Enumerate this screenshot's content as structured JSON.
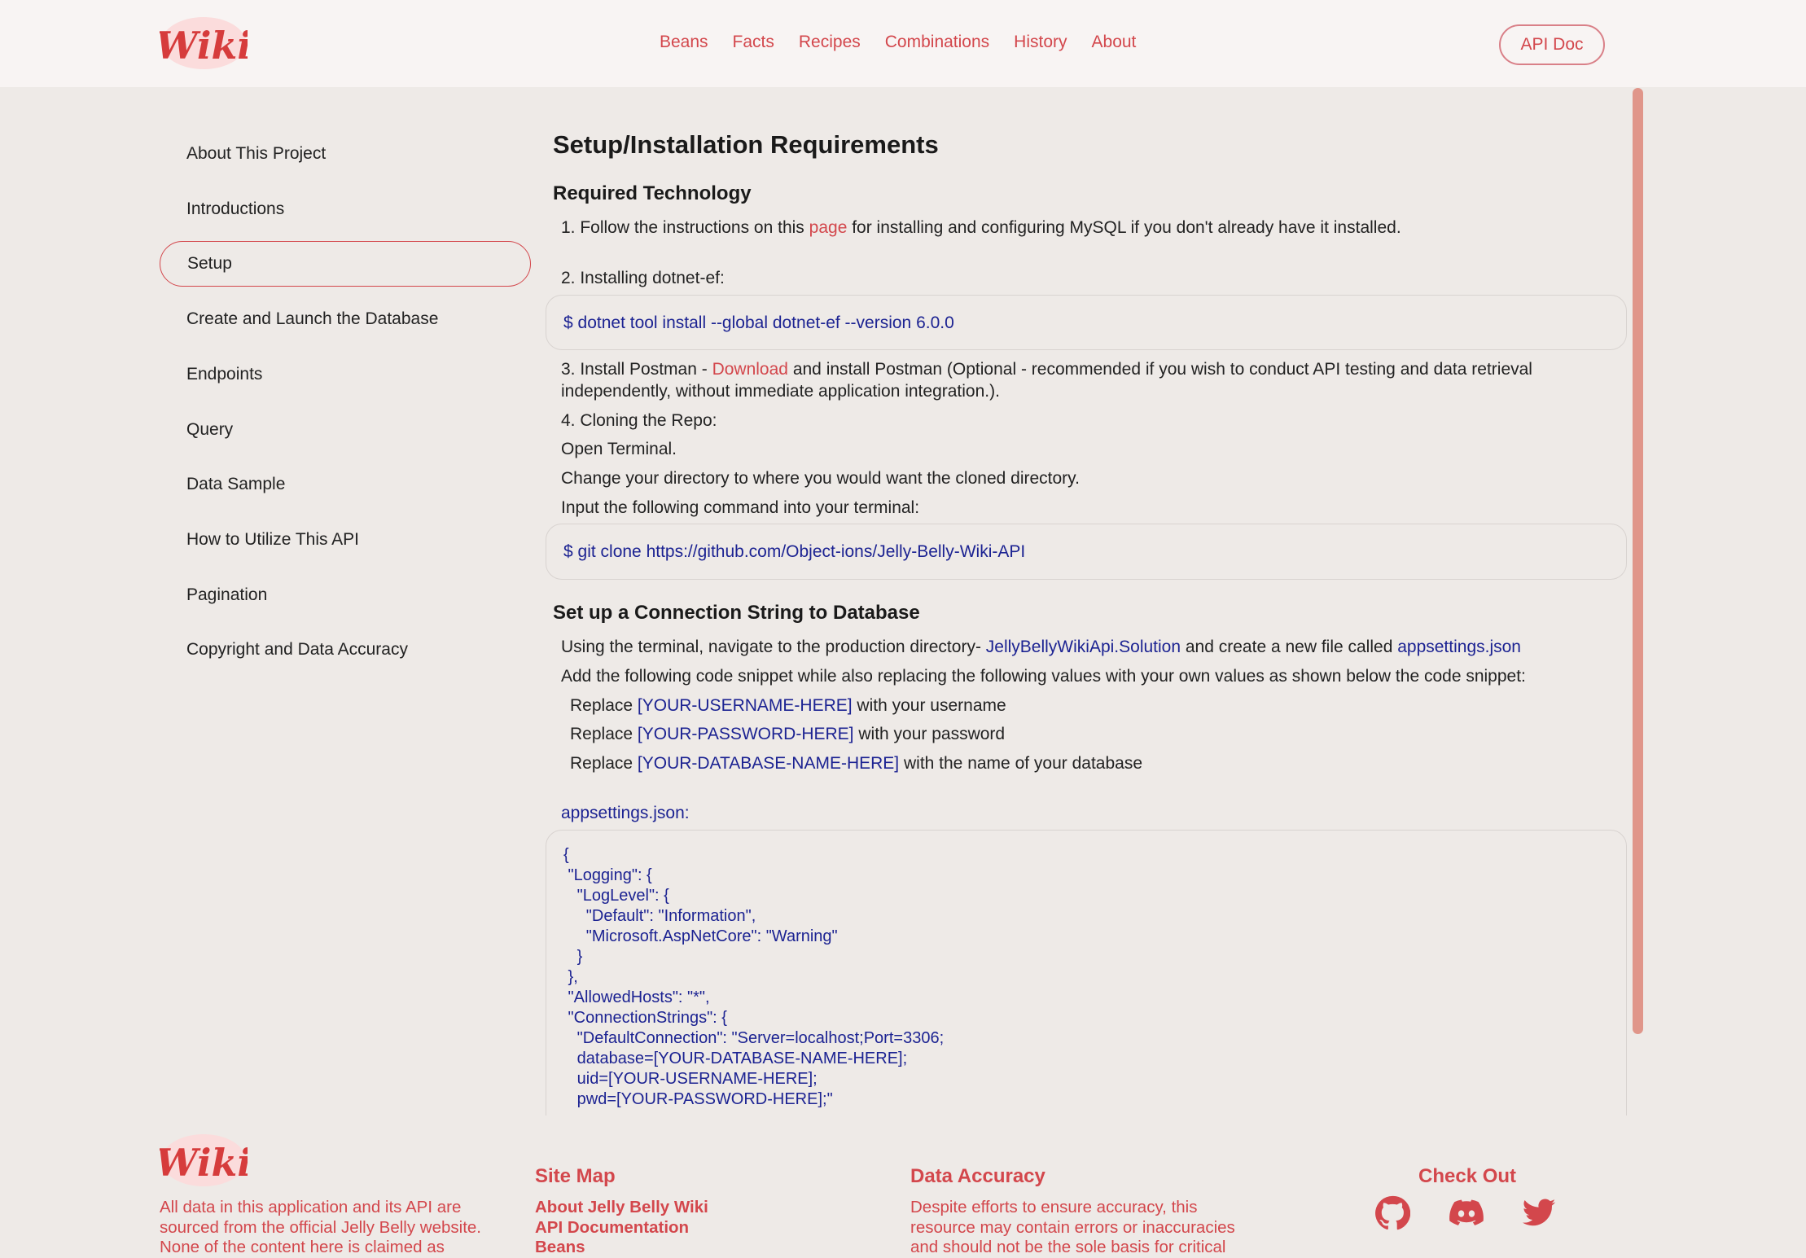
{
  "header": {
    "logo_text": "Wiki",
    "nav": [
      "Beans",
      "Facts",
      "Recipes",
      "Combinations",
      "History",
      "About"
    ],
    "api_doc": "API Doc"
  },
  "sidebar": {
    "items": [
      "About This Project",
      "Introductions",
      "Setup",
      "Create and Launch the Database",
      "Endpoints",
      "Query",
      "Data Sample",
      "How to Utilize This API",
      "Pagination",
      "Copyright and Data Accuracy"
    ]
  },
  "main": {
    "title": "Setup/Installation Requirements",
    "required_heading": "Required Technology",
    "step1_a": "1. Follow the instructions on this ",
    "step1_link": "page",
    "step1_b": " for installing and configuring MySQL if you don't already have it installed.",
    "step2": "2. Installing dotnet-ef:",
    "code1": "$ dotnet tool install --global dotnet-ef --version 6.0.0",
    "step3_a": "3. Install Postman - ",
    "step3_link": "Download",
    "step3_b": " and install Postman (Optional - recommended if you wish to conduct API testing and data retrieval",
    "step3_c": "independently, without immediate application integration.).",
    "step4": "4. Cloning the Repo:",
    "open_terminal": "Open Terminal.",
    "change_dir": "Change your directory to where you would want the cloned directory.",
    "input_cmd": "Input the following command into your terminal:",
    "code2": "$ git clone https://github.com/Object-ions/Jelly-Belly-Wiki-API",
    "conn_heading": "Set up a Connection String to Database",
    "using_a": "Using the terminal, navigate to the production directory- ",
    "using_dir": "JellyBellyWikiApi.Solution",
    "using_b": " and create a new file called ",
    "using_file": "appsettings.json",
    "add_snippet": "Add the following code snippet while also replacing the following values with your own values as shown below the code snippet:",
    "replace_word": "Replace ",
    "replace": [
      {
        "key": "[YOUR-USERNAME-HERE]",
        "text": " with your username"
      },
      {
        "key": "[YOUR-PASSWORD-HERE]",
        "text": " with your password"
      },
      {
        "key": "[YOUR-DATABASE-NAME-HERE]",
        "text": " with the name of your database"
      }
    ],
    "appsettings_label": "appsettings.json:",
    "code3": "{\n \"Logging\": {\n   \"LogLevel\": {\n     \"Default\": \"Information\",\n     \"Microsoft.AspNetCore\": \"Warning\"\n   }\n },\n \"AllowedHosts\": \"*\",\n \"ConnectionStrings\": {\n   \"DefaultConnection\": \"Server=localhost;Port=3306;\n   database=[YOUR-DATABASE-NAME-HERE];\n   uid=[YOUR-USERNAME-HERE];\n   pwd=[YOUR-PASSWORD-HERE];\""
  },
  "footer": {
    "about_lines": [
      "All data in this application and its API are",
      "sourced from the official Jelly Belly website.",
      "None of the content here is claimed as"
    ],
    "sitemap_heading": "Site Map",
    "sitemap": [
      "About Jelly Belly Wiki",
      "API Documentation",
      "Beans"
    ],
    "accuracy_heading": "Data Accuracy",
    "accuracy_lines": [
      "Despite efforts to ensure accuracy, this",
      "resource may contain errors or inaccuracies",
      "and should not be the sole basis for critical"
    ],
    "checkout_heading": "Check Out"
  },
  "colors": {
    "accent": "#d3474c",
    "link": "#1c2392",
    "scrollbar": "#e0968a"
  }
}
